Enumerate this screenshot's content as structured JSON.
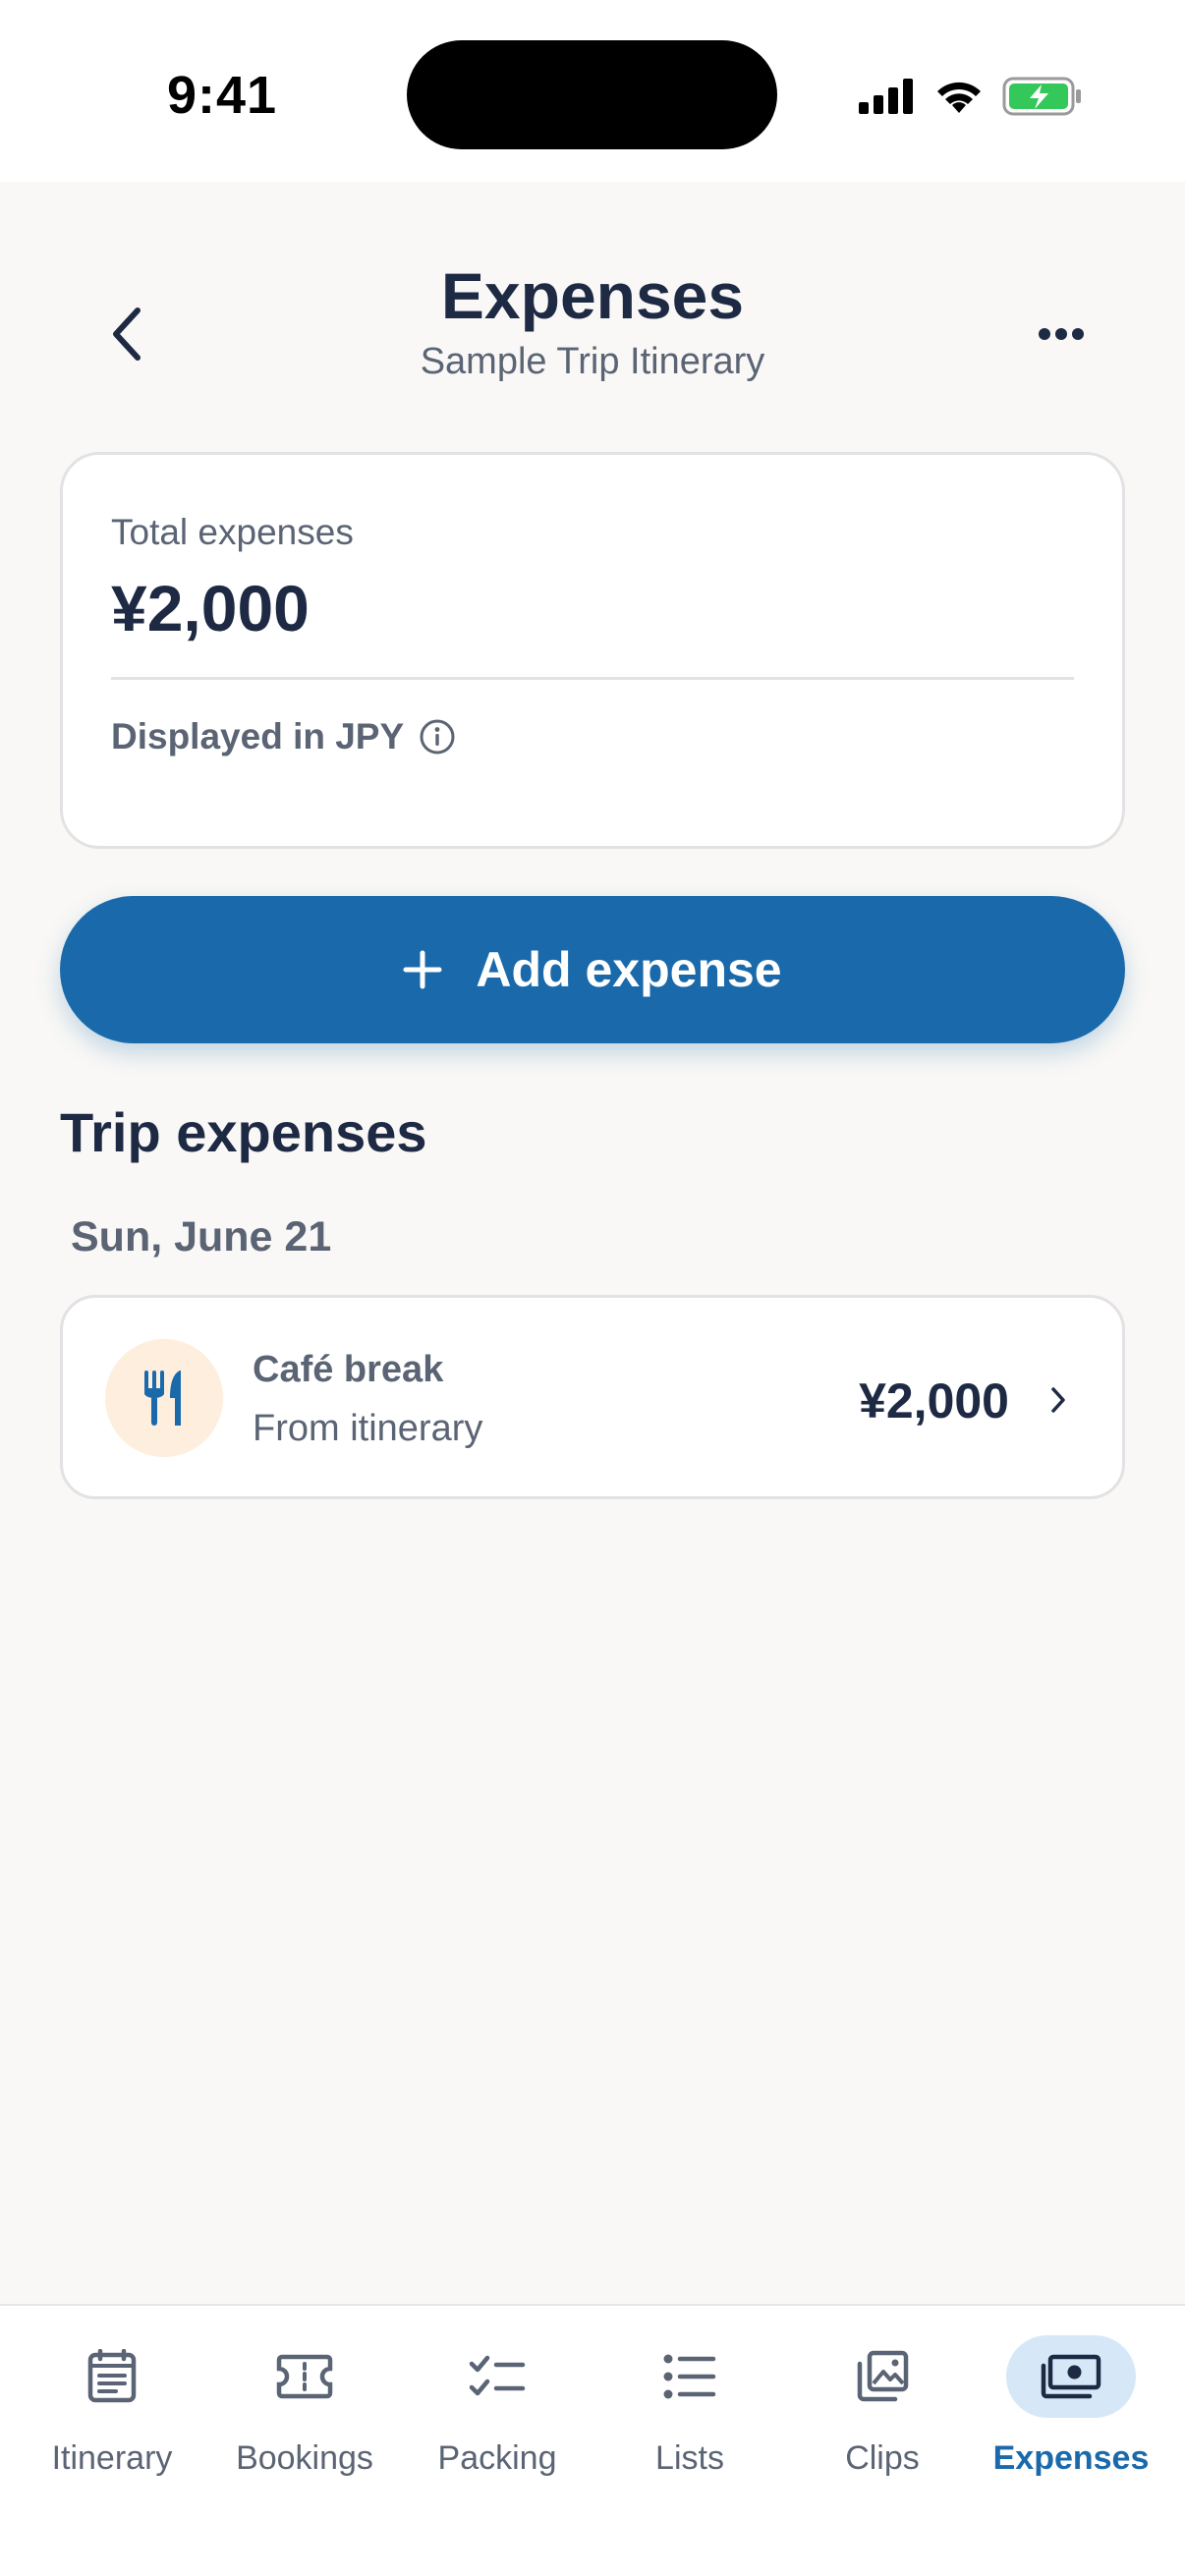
{
  "status_bar": {
    "time": "9:41",
    "icons": [
      "cellular-signal-icon",
      "wifi-icon",
      "battery-charging-icon"
    ]
  },
  "header": {
    "title": "Expenses",
    "subtitle": "Sample Trip Itinerary",
    "back_icon": "chevron-left-icon",
    "more_icon": "more-horizontal-icon"
  },
  "summary": {
    "label": "Total expenses",
    "total": "¥2,000",
    "currency_note": "Displayed in JPY",
    "info_icon": "info-icon"
  },
  "add_button": {
    "label": "Add expense",
    "icon": "plus-icon"
  },
  "section": {
    "title": "Trip expenses"
  },
  "groups": [
    {
      "date": "Sun, June 21",
      "items": [
        {
          "name": "Café break",
          "source": "From itinerary",
          "amount": "¥2,000",
          "icon": "fork-knife-icon"
        }
      ]
    }
  ],
  "tabs": [
    {
      "label": "Itinerary",
      "icon": "itinerary-icon",
      "active": false
    },
    {
      "label": "Bookings",
      "icon": "ticket-icon",
      "active": false
    },
    {
      "label": "Packing",
      "icon": "checklist-icon",
      "active": false
    },
    {
      "label": "Lists",
      "icon": "list-icon",
      "active": false
    },
    {
      "label": "Clips",
      "icon": "photos-icon",
      "active": false
    },
    {
      "label": "Expenses",
      "icon": "money-icon",
      "active": true
    }
  ],
  "colors": {
    "accent": "#1a6aab",
    "text_primary": "#1e2a44",
    "text_secondary": "#5b6474",
    "background": "#f9f8f6",
    "food_icon_bg": "#fdeedd",
    "active_tab_bg": "#d6e8f7",
    "battery": "#34c759"
  }
}
